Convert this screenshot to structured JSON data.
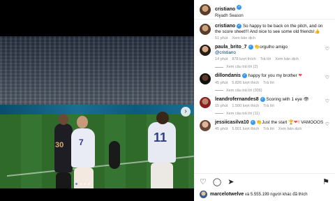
{
  "post": {
    "username": "cristiano",
    "location": "Riyadh Season",
    "caption": {
      "username": "cristiano",
      "text": "So happy to be back on the pitch, and on the score sheet!!! And nice to see some old friends!",
      "emoji": "👍",
      "time": "51 phút",
      "translate": "Xem bản dịch"
    }
  },
  "photo": {
    "jersey_numbers": [
      "30",
      "7",
      "11"
    ],
    "next_icon": "chevron-right-icon",
    "carousel_dots": 4,
    "active_dot": 0
  },
  "comments": [
    {
      "username": "paula_brito_7",
      "verified": true,
      "text_emoji": "👏",
      "text": "orgulho amigo",
      "mention": "@cristiano",
      "time": "14 phút",
      "likes": "878 lượt thích",
      "reply": "Trả lời",
      "translate": "Xem bản dịch",
      "replies": "Xem câu trả lời (2)"
    },
    {
      "username": "dillondanis",
      "verified": true,
      "text": "happy for you my brother",
      "text_emoji": "❤",
      "time": "45 phút",
      "likes": "5.826 lượt thích",
      "reply": "Trả lời",
      "replies": "Xem câu trả lời (306)"
    },
    {
      "username": "leandrofernandes8",
      "verified": true,
      "text": "Scoring with 1 eye",
      "text_emoji": "👁",
      "time": "15 phút",
      "likes": "1.500 lượt thích",
      "reply": "Trả lời",
      "replies": "Xem câu trả lời (11)"
    },
    {
      "username": "jessiicasilva10",
      "verified": true,
      "text_emoji": "👏",
      "text": "Just the start",
      "text_emoji2": "🏆❤‼",
      "text2": "VAMOOOS",
      "time": "45 phút",
      "likes": "5.601 lượt thích",
      "reply": "Trả lời",
      "translate": "Xem bản dịch"
    }
  ],
  "actions": {
    "like_icon": "heart-icon",
    "comment_icon": "comment-icon",
    "share_icon": "share-icon",
    "save_icon": "bookmark-icon",
    "liked_by": "marcelotwelve",
    "liked_text": "và 5.555.199 người khác",
    "liked_suffix": "đã thích"
  }
}
